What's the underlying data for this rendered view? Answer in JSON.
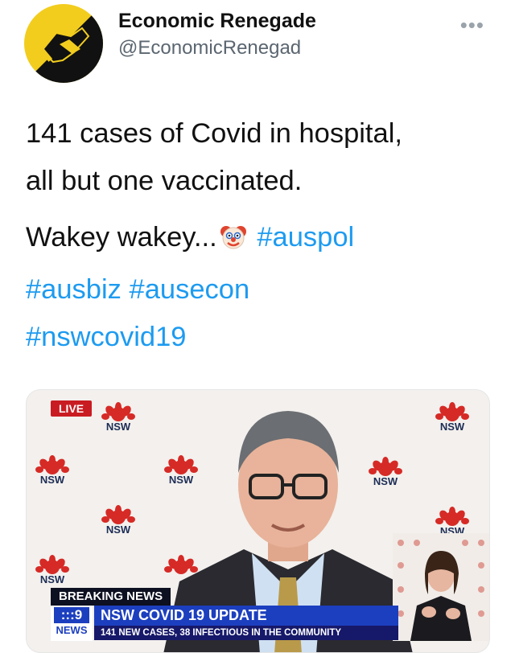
{
  "account": {
    "display_name": "Economic Renegade",
    "handle": "@EconomicRenegad",
    "more_label": "•••"
  },
  "tweet": {
    "line1": "141 cases of Covid in hospital,",
    "line2": "all but one vaccinated.",
    "wakey": "Wakey wakey...",
    "emoji": "clown-face",
    "hashtags": [
      "#auspol",
      "#ausbiz",
      "#ausecon",
      "#nswcovid19"
    ]
  },
  "media": {
    "live_label": "LIVE",
    "logo_text": "NSW",
    "breaking_label": "BREAKING NEWS",
    "channel_number": ":::9",
    "channel_label": "NEWS",
    "headline": "NSW COVID 19 UPDATE",
    "subheadline": "141 NEW CASES, 38 INFECTIOUS IN THE COMMUNITY"
  },
  "colors": {
    "hashtag": "#1d9bf0",
    "avatar_bg": "#f2cd1e",
    "live_red": "#c91c22",
    "news_blue": "#1c3fbf"
  }
}
